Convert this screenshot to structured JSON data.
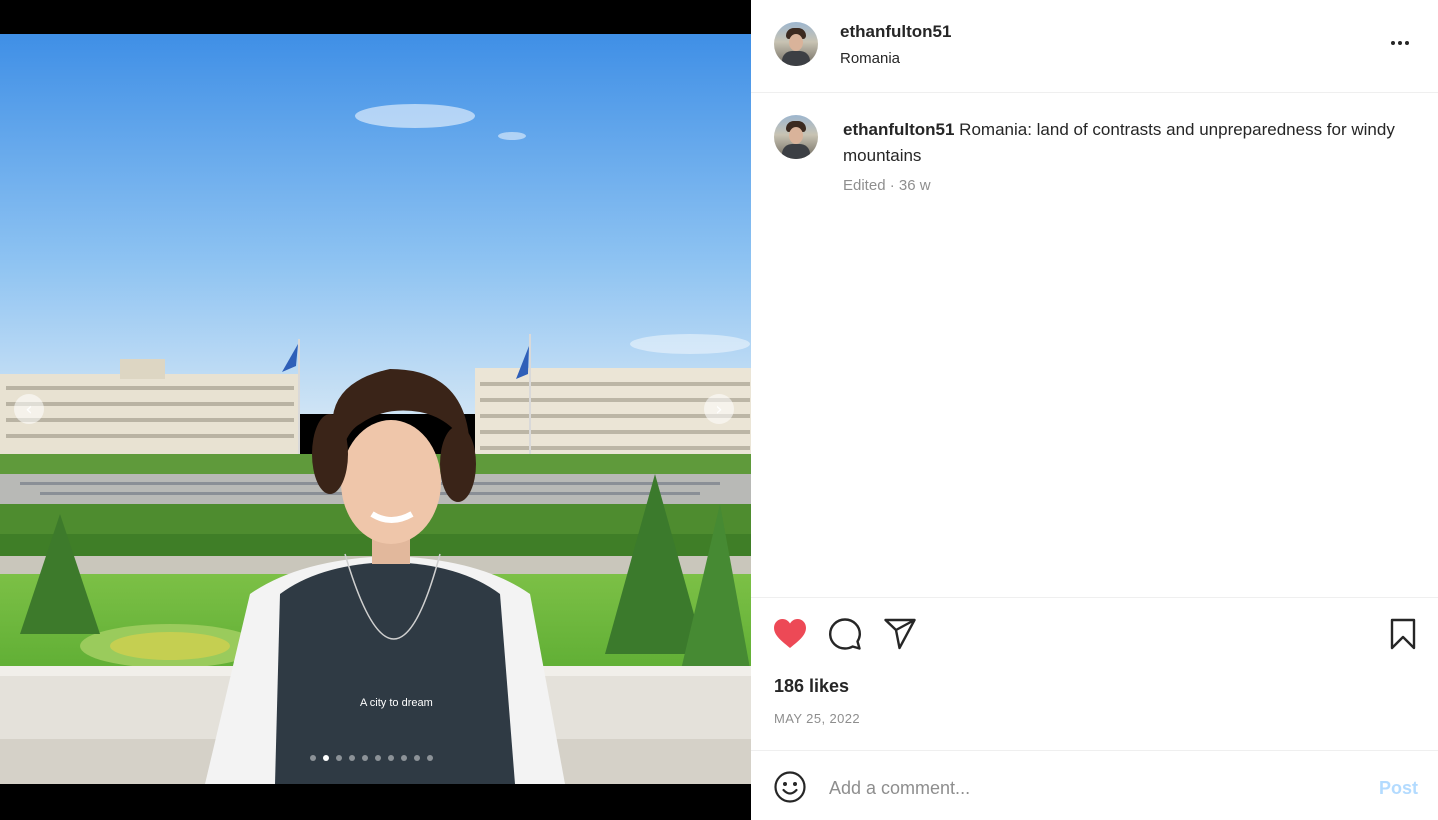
{
  "post": {
    "username": "ethanfulton51",
    "location": "Romania",
    "caption_username": "ethanfulton51",
    "caption_text": " Romania: land of contrasts and unpreparedness for windy mountains",
    "caption_meta": "Edited · 36 w",
    "likes": "186 likes",
    "date": "MAY 25, 2022",
    "shirt_text": "A city to dream"
  },
  "carousel": {
    "slide_count": 10,
    "active_index": 1
  },
  "actions": {
    "liked": true,
    "like_icon": "heart-filled-icon",
    "comment_icon": "comment-bubble-icon",
    "share_icon": "paper-plane-icon",
    "save_icon": "bookmark-icon",
    "more_icon": "more-horizontal-icon"
  },
  "comment_bar": {
    "placeholder": "Add a comment...",
    "post_label": "Post",
    "emoji_icon": "smiley-icon"
  },
  "colors": {
    "like_red": "#ed4956",
    "post_disabled": "#b3dbff",
    "secondary_text": "#8e8e8e"
  }
}
